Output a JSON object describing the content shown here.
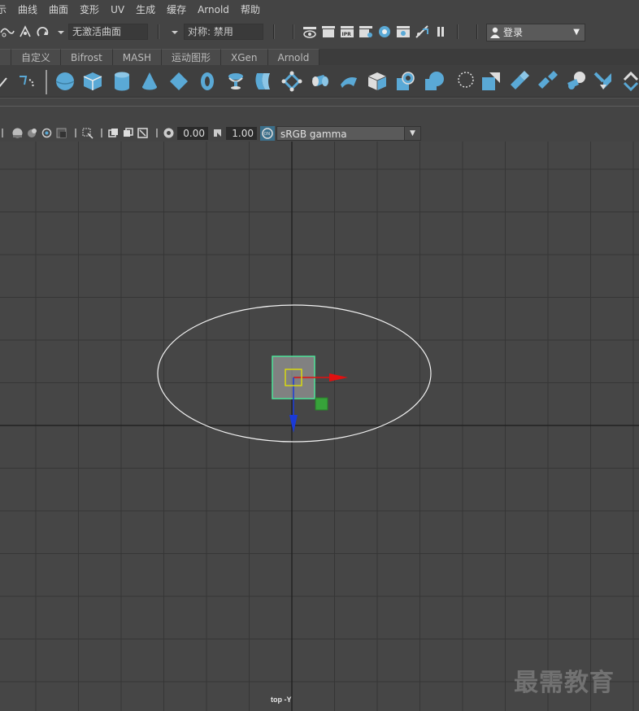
{
  "menu": {
    "items": [
      "示",
      "曲线",
      "曲面",
      "变形",
      "UV",
      "生成",
      "缓存",
      "Arnold",
      "帮助"
    ]
  },
  "status_line": {
    "surface_field": "无激活曲面",
    "symmetry_field": "对称: 禁用",
    "login_label": "登录"
  },
  "shelf_tabs": [
    "",
    "自定义",
    "Bifrost",
    "MASH",
    "运动图形",
    "XGen",
    "Arnold"
  ],
  "panel_toolbar": {
    "exposure_value": "0.00",
    "gamma_value": "1.00",
    "color_space": "sRGB gamma"
  },
  "viewport": {
    "camera_label": "top -Y",
    "watermark": "最需教育"
  },
  "colors": {
    "shelf_icon": "#5aa9d6",
    "grid_line": "#363636",
    "axis_line": "#222222",
    "manipulator_x": "#e01010",
    "manipulator_z": "#1a3ad8",
    "selection": "#4fe49a",
    "pivot": "#e6e600"
  }
}
